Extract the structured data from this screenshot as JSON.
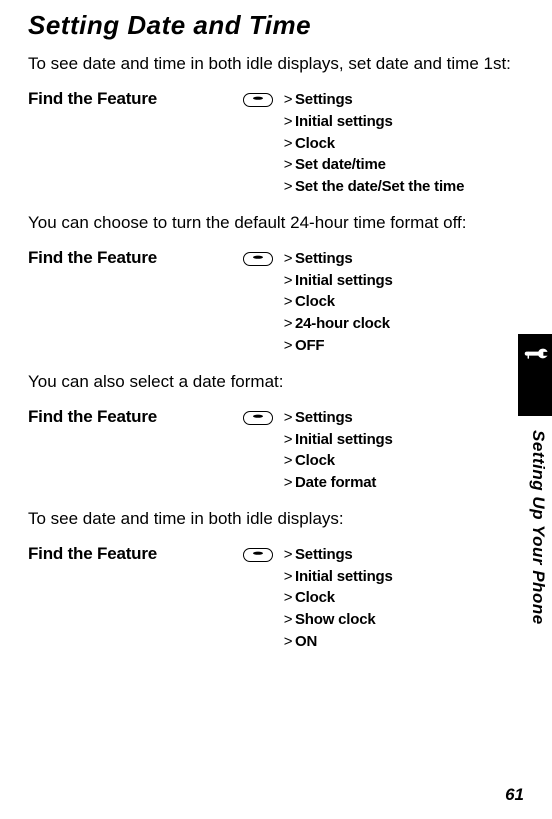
{
  "title": "Setting Date and Time",
  "intro1": "To see date and time in both idle displays, set date and time 1st:",
  "intro2": "You can choose to turn the default 24-hour time format off:",
  "intro3": "You can also select a date format:",
  "intro4": "To see date and time in both idle displays:",
  "feature_label": "Find the Feature",
  "side_label": "Setting Up Your Phone",
  "page_number": "61",
  "nav1": {
    "s0": "Settings",
    "s1": "Initial settings",
    "s2": "Clock",
    "s3": "Set date/time",
    "s4": "Set the date/Set the time"
  },
  "nav2": {
    "s0": "Settings",
    "s1": "Initial settings",
    "s2": "Clock",
    "s3": "24-hour clock",
    "s4": "OFF"
  },
  "nav3": {
    "s0": "Settings",
    "s1": "Initial settings",
    "s2": "Clock",
    "s3": "Date format"
  },
  "nav4": {
    "s0": "Settings",
    "s1": "Initial settings",
    "s2": "Clock",
    "s3": "Show clock",
    "s4": "ON"
  }
}
